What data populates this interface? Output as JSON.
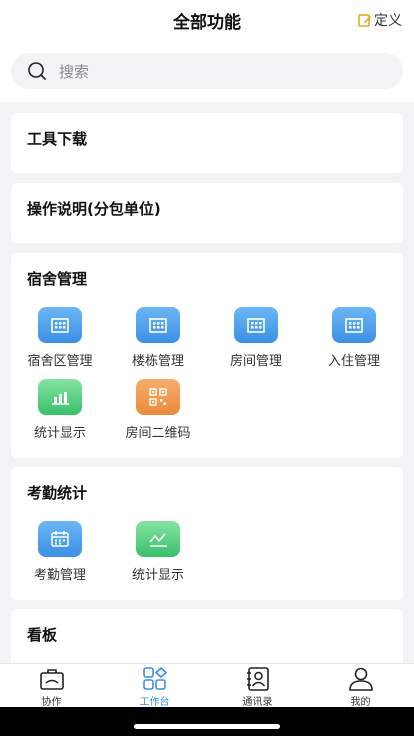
{
  "header": {
    "title": "全部功能",
    "custom_label": "定义"
  },
  "search": {
    "placeholder": "搜索"
  },
  "sections": {
    "tools": {
      "title": "工具下载"
    },
    "manual": {
      "title": "操作说明(分包单位)"
    },
    "dorm": {
      "title": "宿舍管理",
      "items": [
        {
          "label": "宿舍区管理",
          "icon": "building-icon",
          "color": "#4a9df0"
        },
        {
          "label": "楼栋管理",
          "icon": "building-icon",
          "color": "#4a9df0"
        },
        {
          "label": "房间管理",
          "icon": "building-icon",
          "color": "#4a9df0"
        },
        {
          "label": "入住管理",
          "icon": "building-icon",
          "color": "#4a9df0"
        },
        {
          "label": "统计显示",
          "icon": "bar-chart-icon",
          "color": "#4ccd7a"
        },
        {
          "label": "房间二维码",
          "icon": "qr-code-icon",
          "color": "#ef9548"
        }
      ]
    },
    "attendance": {
      "title": "考勤统计",
      "items": [
        {
          "label": "考勤管理",
          "icon": "calendar-icon",
          "color": "#4a9df0"
        },
        {
          "label": "统计显示",
          "icon": "line-chart-icon",
          "color": "#4ccd7a"
        }
      ]
    },
    "board": {
      "title": "看板"
    }
  },
  "tabbar": {
    "active": "工作台",
    "items": [
      {
        "label": "协作",
        "icon": "briefcase-icon"
      },
      {
        "label": "工作台",
        "icon": "workbench-grid-icon"
      },
      {
        "label": "通讯录",
        "icon": "contacts-book-icon"
      },
      {
        "label": "我的",
        "icon": "person-icon"
      }
    ]
  }
}
